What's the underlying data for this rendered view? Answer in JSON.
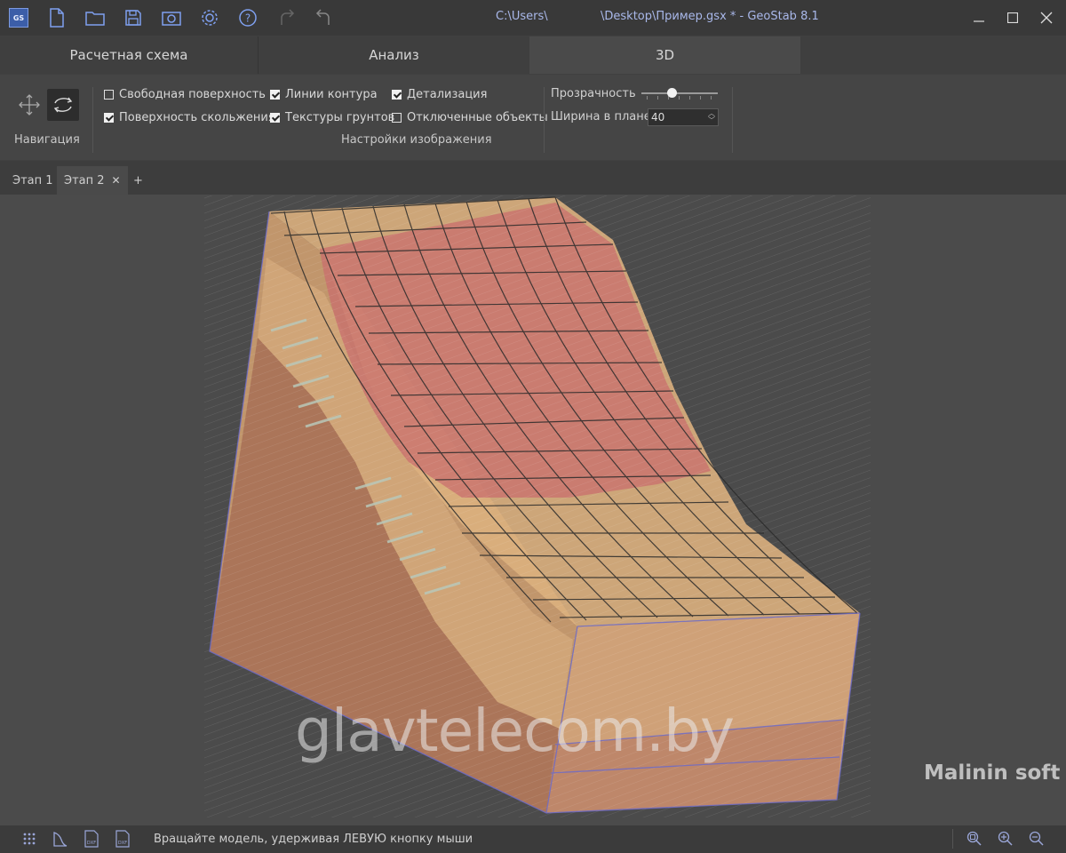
{
  "window": {
    "title_path": "C:\\Users\\",
    "title_rest": "\\Desktop\\Пример.gsx * - GeoStab 8.1",
    "app_logo_text": "GS"
  },
  "main_tabs": [
    {
      "label": "Расчетная схема",
      "active": false
    },
    {
      "label": "Анализ",
      "active": false
    },
    {
      "label": "3D",
      "active": true
    }
  ],
  "ribbon": {
    "navigation_label": "Навигация",
    "image_settings_label": "Настройки изображения",
    "checkboxes": [
      {
        "label": "Свободная поверхность",
        "checked": false
      },
      {
        "label": "Поверхность скольжения",
        "checked": true
      },
      {
        "label": "Линии контура",
        "checked": true
      },
      {
        "label": "Текстуры грунтов",
        "checked": true
      },
      {
        "label": "Детализация",
        "checked": true
      },
      {
        "label": "Отключенные объекты",
        "checked": false
      }
    ],
    "transparency_label": "Прозрачность",
    "transparency_level": 0.4,
    "plan_width_label": "Ширина в плане",
    "plan_width_value": "40"
  },
  "stage_tabs": [
    {
      "label": "Этап 1",
      "active": false
    },
    {
      "label": "Этап 2",
      "active": true
    }
  ],
  "add_tab_label": "+",
  "close_tab_label": "✕",
  "viewport": {
    "watermark": "glavtelecom.by",
    "brand": "Malinin soft"
  },
  "status": {
    "text": "Вращайте модель, удерживая ЛЕВУЮ кнопку мыши"
  },
  "colors": {
    "accent_title": "#a9b8ea",
    "background": "#404040",
    "slip_surface": "#c86e6e",
    "soil_light": "#e8b878",
    "soil_dark": "#b07a5c"
  }
}
